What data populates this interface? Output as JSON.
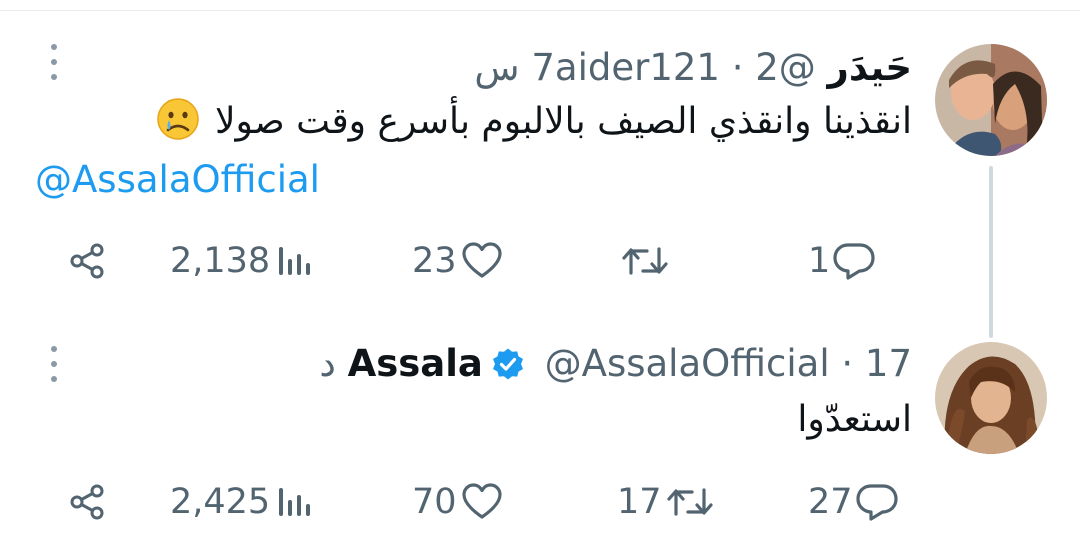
{
  "tweets": [
    {
      "display_name": "حَيدَر",
      "handle": "@7aider121",
      "separator": "·",
      "time": "2 س",
      "text": "انقذينا وانقذي الصيف بالالبوم بأسرع وقت صولا",
      "emoji": "crying-face",
      "mention": "@AssalaOfficial",
      "verified": false,
      "stats": {
        "replies": "1",
        "retweets": "",
        "likes": "23",
        "views": "2,138"
      }
    },
    {
      "display_name": "Assala",
      "handle": "@AssalaOfficial",
      "separator": "·",
      "time": "17 د",
      "text": "استعدّوا",
      "verified": true,
      "stats": {
        "replies": "27",
        "retweets": "17",
        "likes": "70",
        "views": "2,425"
      }
    }
  ],
  "colors": {
    "link": "#1d9bf0",
    "secondary_text": "#536471",
    "primary_text": "#0f1419",
    "verified_badge": "#1d9bf0",
    "thread_line": "#cfd9de"
  },
  "icons": [
    "more-vertical-icon",
    "verified-badge-icon",
    "share-icon",
    "views-icon",
    "like-icon",
    "retweet-icon",
    "reply-icon",
    "crying-face-emoji"
  ]
}
